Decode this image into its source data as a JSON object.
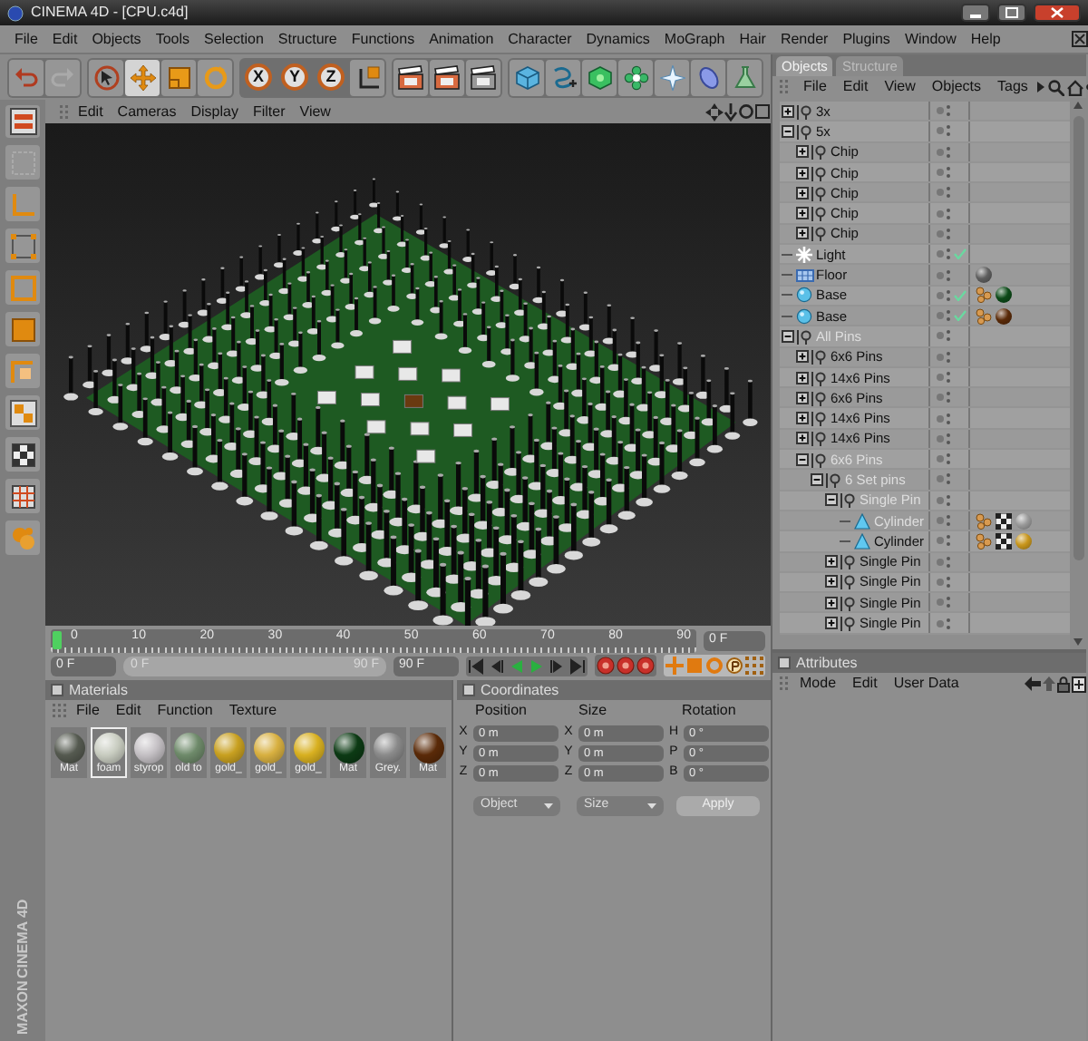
{
  "window": {
    "title": "CINEMA 4D - [CPU.c4d]"
  },
  "menu_bar": [
    "File",
    "Edit",
    "Objects",
    "Tools",
    "Selection",
    "Structure",
    "Functions",
    "Animation",
    "Character",
    "Dynamics",
    "MoGraph",
    "Hair",
    "Render",
    "Plugins",
    "Window",
    "Help"
  ],
  "toolbar": {
    "tools": [
      {
        "kind": "select",
        "selected": false
      },
      {
        "kind": "move",
        "selected": true
      },
      {
        "kind": "scale",
        "selected": false
      },
      {
        "kind": "rotate",
        "selected": false
      }
    ],
    "axes": [
      "X",
      "Y",
      "Z"
    ]
  },
  "viewport": {
    "menu": [
      "Edit",
      "Cameras",
      "Display",
      "Filter",
      "View"
    ]
  },
  "timeline": {
    "ruler_labels": [
      "0",
      "10",
      "20",
      "30",
      "40",
      "50",
      "60",
      "70",
      "80",
      "90"
    ],
    "level": 0,
    "current_frame": "0 F",
    "start_frame": "0 F",
    "range": {
      "start": "0 F",
      "end": "90 F",
      "level": 1
    },
    "end_frame": "90 F"
  },
  "materials": {
    "title": "Materials",
    "checked": false,
    "menu": [
      "File",
      "Edit",
      "Function",
      "Texture"
    ],
    "items": [
      {
        "name": "Mat",
        "color": "#555a50",
        "selected": false
      },
      {
        "name": "foam",
        "color": "#c8ccc0",
        "selected": true
      },
      {
        "name": "styrop",
        "color": "#c4c0c4",
        "selected": false
      },
      {
        "name": "old to",
        "color": "#6e8a6a",
        "selected": false
      },
      {
        "name": "gold_",
        "color": "#c8a020",
        "selected": false
      },
      {
        "name": "gold_",
        "color": "#d8b040",
        "selected": false
      },
      {
        "name": "gold_",
        "color": "#d8b020",
        "selected": false
      },
      {
        "name": "Mat",
        "color": "#0c3a14",
        "selected": false
      },
      {
        "name": "Grey.",
        "color": "#8a8a8a",
        "selected": false
      },
      {
        "name": "Mat",
        "color": "#5a2a08",
        "selected": false
      }
    ]
  },
  "coordinates": {
    "title": "Coordinates",
    "checked": false,
    "columns": [
      "Position",
      "Size",
      "Rotation"
    ],
    "rows": [
      {
        "labels": [
          "X",
          "X",
          "H"
        ],
        "values": [
          "0 m",
          "0 m",
          "0 °"
        ]
      },
      {
        "labels": [
          "Y",
          "Y",
          "P"
        ],
        "values": [
          "0 m",
          "0 m",
          "0 °"
        ]
      },
      {
        "labels": [
          "Z",
          "Z",
          "B"
        ],
        "values": [
          "0 m",
          "0 m",
          "0 °"
        ]
      }
    ],
    "dropdowns": [
      "Object",
      "Size"
    ],
    "apply": "Apply"
  },
  "objects": {
    "tabs": [
      {
        "label": "Objects",
        "selected": true
      },
      {
        "label": "Structure",
        "selected": false
      }
    ],
    "menu": [
      "File",
      "Edit",
      "View",
      "Objects",
      "Tags"
    ],
    "tree": [
      {
        "name": "3x",
        "kind": "null",
        "expanded": false,
        "dimmed": false,
        "check": false
      },
      {
        "name": "5x",
        "kind": "null",
        "expanded": true,
        "dimmed": false,
        "check": false,
        "children": [
          {
            "name": "Chip",
            "kind": "null",
            "expanded": false,
            "dimmed": false,
            "check": false
          },
          {
            "name": "Chip",
            "kind": "null",
            "expanded": false,
            "dimmed": false,
            "check": false
          },
          {
            "name": "Chip",
            "kind": "null",
            "expanded": false,
            "dimmed": false,
            "check": false
          },
          {
            "name": "Chip",
            "kind": "null",
            "expanded": false,
            "dimmed": false,
            "check": false
          },
          {
            "name": "Chip",
            "kind": "null",
            "expanded": false,
            "dimmed": false,
            "check": false
          }
        ]
      },
      {
        "name": "Light",
        "kind": "light",
        "dimmed": false,
        "check": true
      },
      {
        "name": "Floor",
        "kind": "floor",
        "dimmed": false,
        "check": false,
        "tags": [
          {
            "kind": "material",
            "color": "#5e5e5e"
          }
        ]
      },
      {
        "name": "Base",
        "kind": "sphere",
        "dimmed": false,
        "check": true,
        "tags": [
          {
            "kind": "phong"
          },
          {
            "kind": "material",
            "color": "#0c4a18"
          }
        ]
      },
      {
        "name": "Base",
        "kind": "sphere",
        "dimmed": false,
        "check": true,
        "tags": [
          {
            "kind": "phong"
          },
          {
            "kind": "material",
            "color": "#5a2a08"
          }
        ]
      },
      {
        "name": "All Pins",
        "kind": "null",
        "expanded": true,
        "dimmed": true,
        "check": false,
        "children": [
          {
            "name": "6x6 Pins",
            "kind": "null",
            "expanded": false,
            "dimmed": false,
            "check": false
          },
          {
            "name": "14x6 Pins",
            "kind": "null",
            "expanded": false,
            "dimmed": false,
            "check": false
          },
          {
            "name": "6x6 Pins",
            "kind": "null",
            "expanded": false,
            "dimmed": false,
            "check": false
          },
          {
            "name": "14x6 Pins",
            "kind": "null",
            "expanded": false,
            "dimmed": false,
            "check": false
          },
          {
            "name": "14x6 Pins",
            "kind": "null",
            "expanded": false,
            "dimmed": false,
            "check": false
          },
          {
            "name": "6x6 Pins",
            "kind": "null",
            "expanded": true,
            "dimmed": true,
            "check": false,
            "children": [
              {
                "name": "6 Set pins",
                "kind": "null",
                "expanded": true,
                "dimmed": true,
                "check": false,
                "children": [
                  {
                    "name": "Single Pin",
                    "kind": "null",
                    "expanded": true,
                    "dimmed": true,
                    "check": false,
                    "children": [
                      {
                        "name": "Cylinder",
                        "kind": "cylinder",
                        "dimmed": true,
                        "check": false,
                        "tags": [
                          {
                            "kind": "phong"
                          },
                          {
                            "kind": "texture"
                          },
                          {
                            "kind": "material",
                            "color": "#9a9a9a"
                          }
                        ]
                      },
                      {
                        "name": "Cylinder",
                        "kind": "cylinder",
                        "dimmed": false,
                        "check": false,
                        "tags": [
                          {
                            "kind": "phong"
                          },
                          {
                            "kind": "texture"
                          },
                          {
                            "kind": "material",
                            "color": "#c8961c"
                          }
                        ]
                      }
                    ]
                  },
                  {
                    "name": "Single Pin",
                    "kind": "null",
                    "expanded": false,
                    "dimmed": false,
                    "check": false
                  },
                  {
                    "name": "Single Pin",
                    "kind": "null",
                    "expanded": false,
                    "dimmed": false,
                    "check": false
                  },
                  {
                    "name": "Single Pin",
                    "kind": "null",
                    "expanded": false,
                    "dimmed": false,
                    "check": false
                  },
                  {
                    "name": "Single Pin",
                    "kind": "null",
                    "expanded": false,
                    "dimmed": false,
                    "check": false
                  }
                ]
              }
            ]
          }
        ]
      }
    ]
  },
  "attributes": {
    "title": "Attributes",
    "checked": false,
    "menu": [
      "Mode",
      "Edit",
      "User Data"
    ]
  },
  "logo": {
    "lines": [
      "MAXON",
      "CINEMA 4D"
    ]
  }
}
